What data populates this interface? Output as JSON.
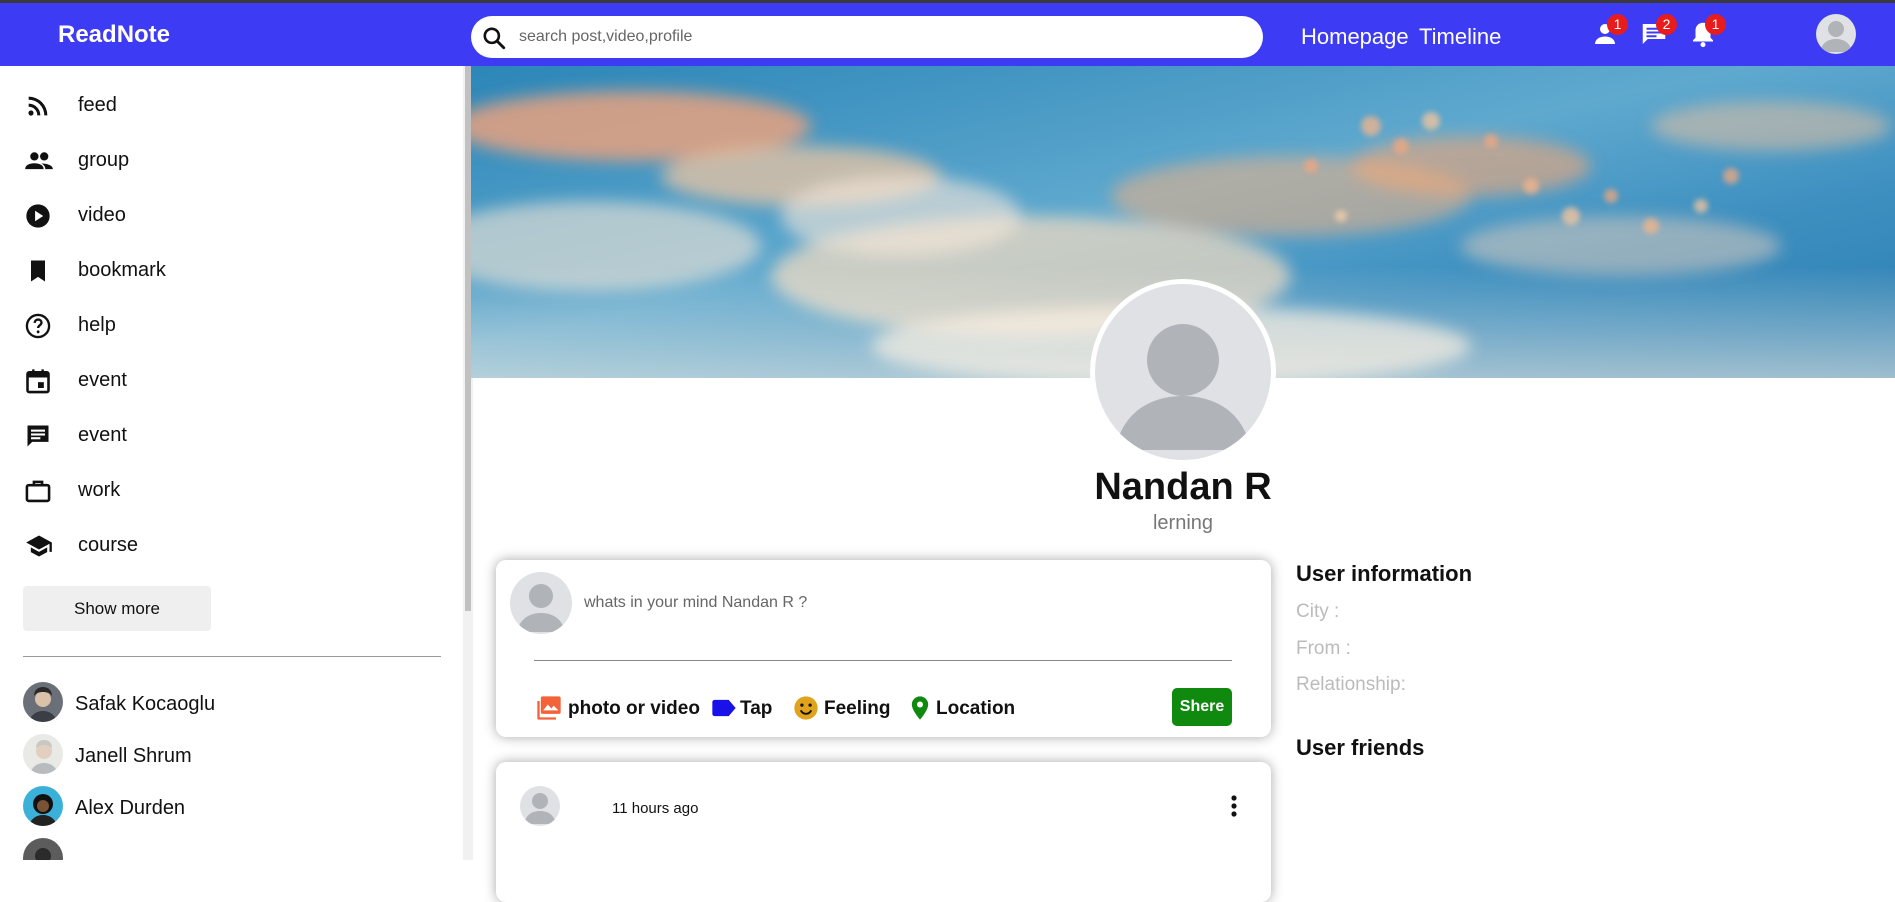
{
  "header": {
    "logo": "ReadNote",
    "search_placeholder": "search post,video,profile",
    "links": [
      "Homepage",
      "Timeline"
    ],
    "badges": {
      "friend_requests": "1",
      "messages": "2",
      "notifications": "1"
    }
  },
  "sidebar": {
    "items": [
      {
        "label": "feed",
        "icon": "rss-feed-icon"
      },
      {
        "label": "group",
        "icon": "group-icon"
      },
      {
        "label": "video",
        "icon": "play-circle-icon"
      },
      {
        "label": "bookmark",
        "icon": "bookmark-icon"
      },
      {
        "label": "help",
        "icon": "help-circle-icon"
      },
      {
        "label": "event",
        "icon": "calendar-event-icon"
      },
      {
        "label": "event",
        "icon": "chat-icon"
      },
      {
        "label": "work",
        "icon": "briefcase-icon"
      },
      {
        "label": "course",
        "icon": "school-icon"
      }
    ],
    "show_more": "Show more",
    "friends": [
      "Safak Kocaoglu",
      "Janell Shrum",
      "Alex Durden"
    ]
  },
  "profile": {
    "name": "Nandan R",
    "description": "lerning"
  },
  "share": {
    "placeholder": "whats in your mind Nandan R ?",
    "options": [
      "photo or video",
      "Tap",
      "Feeling",
      "Location"
    ],
    "button": "Shere",
    "colors": {
      "photo": "#f4623a",
      "tag": "#1a10e8",
      "feeling": "#e0a31c",
      "location": "#0f8a0f",
      "button": "#0f8a0f"
    }
  },
  "post": {
    "time": "11 hours ago"
  },
  "user_info": {
    "title": "User information",
    "city_label": "City :",
    "from_label": "From :",
    "relationship_label": "Relationship:",
    "friends_title": "User friends"
  },
  "colors": {
    "topbar": "#3d3bf3",
    "badge": "#e81c1c"
  }
}
